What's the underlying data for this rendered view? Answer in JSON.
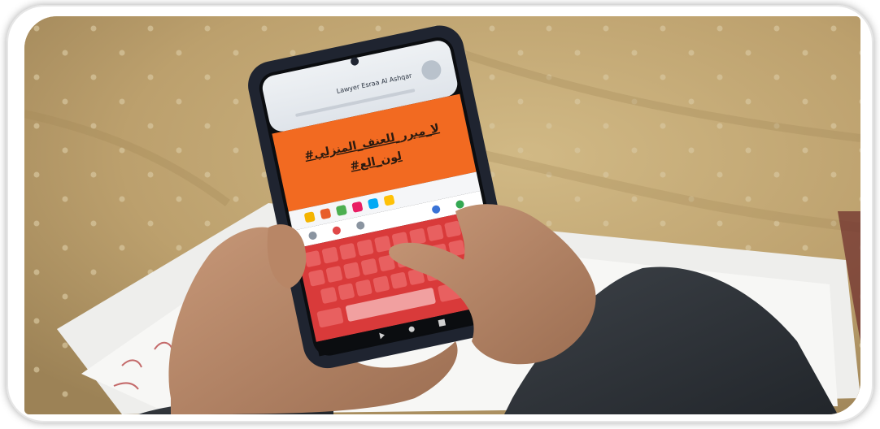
{
  "photo": {
    "description_tag": "photo",
    "colors": {
      "frame": "#ffffff",
      "tablecloth": "#bfa472",
      "paper": "#f4f4f2",
      "phone_body": "#1f2430",
      "post_orange": "#f26a21",
      "keyboard_red": "#d93a3a",
      "sleeve": "#2f3338",
      "skin": "#b88666"
    },
    "phone_screen": {
      "profile_name": "Lawyer Esraa Al Ashqar",
      "post_line1": "#لا_مبرر_للعنف_المنزلي",
      "post_line2": "#لون_الع"
    }
  }
}
